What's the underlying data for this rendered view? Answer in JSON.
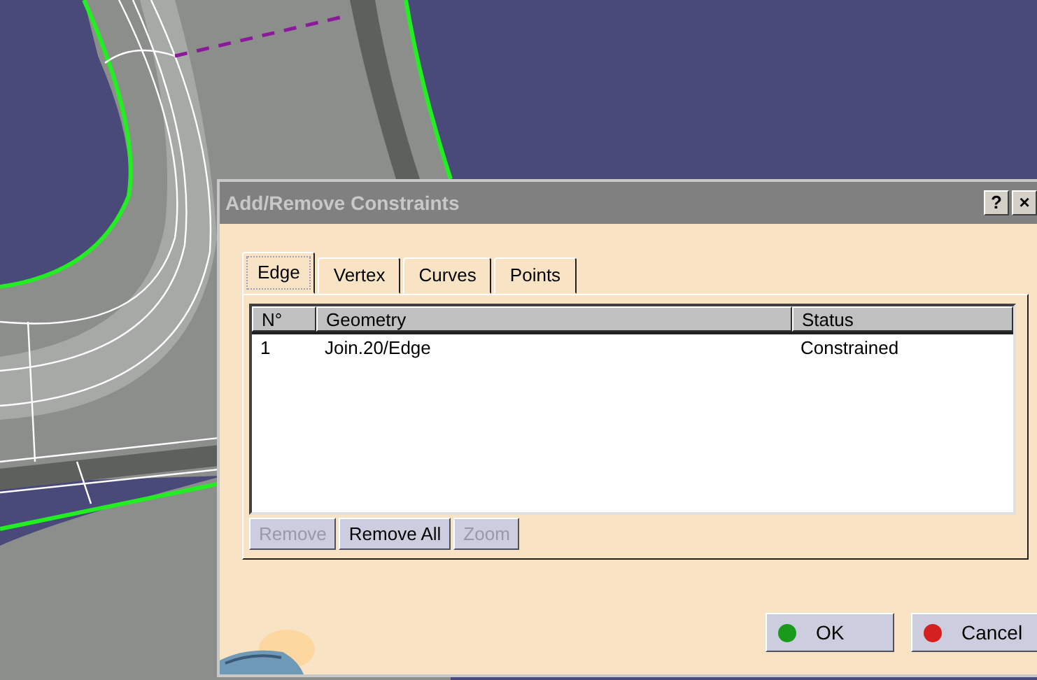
{
  "dialog": {
    "title": "Add/Remove Constraints",
    "title_buttons": [
      "?",
      "×"
    ],
    "tabs": [
      {
        "label": "Edge",
        "selected": true
      },
      {
        "label": "Vertex",
        "selected": false
      },
      {
        "label": "Curves",
        "selected": false
      },
      {
        "label": "Points",
        "selected": false
      }
    ],
    "table": {
      "columns": [
        "N°",
        "Geometry",
        "Status"
      ],
      "rows": [
        [
          "1",
          "Join.20/Edge",
          "Constrained"
        ]
      ]
    },
    "list_buttons": [
      {
        "label": "Remove",
        "disabled": true
      },
      {
        "label": "Remove All",
        "disabled": false
      },
      {
        "label": "Zoom",
        "disabled": true
      }
    ],
    "buttons": [
      {
        "label": "OK",
        "kind": "ok"
      },
      {
        "label": "Cancel",
        "kind": "cancel"
      }
    ]
  }
}
